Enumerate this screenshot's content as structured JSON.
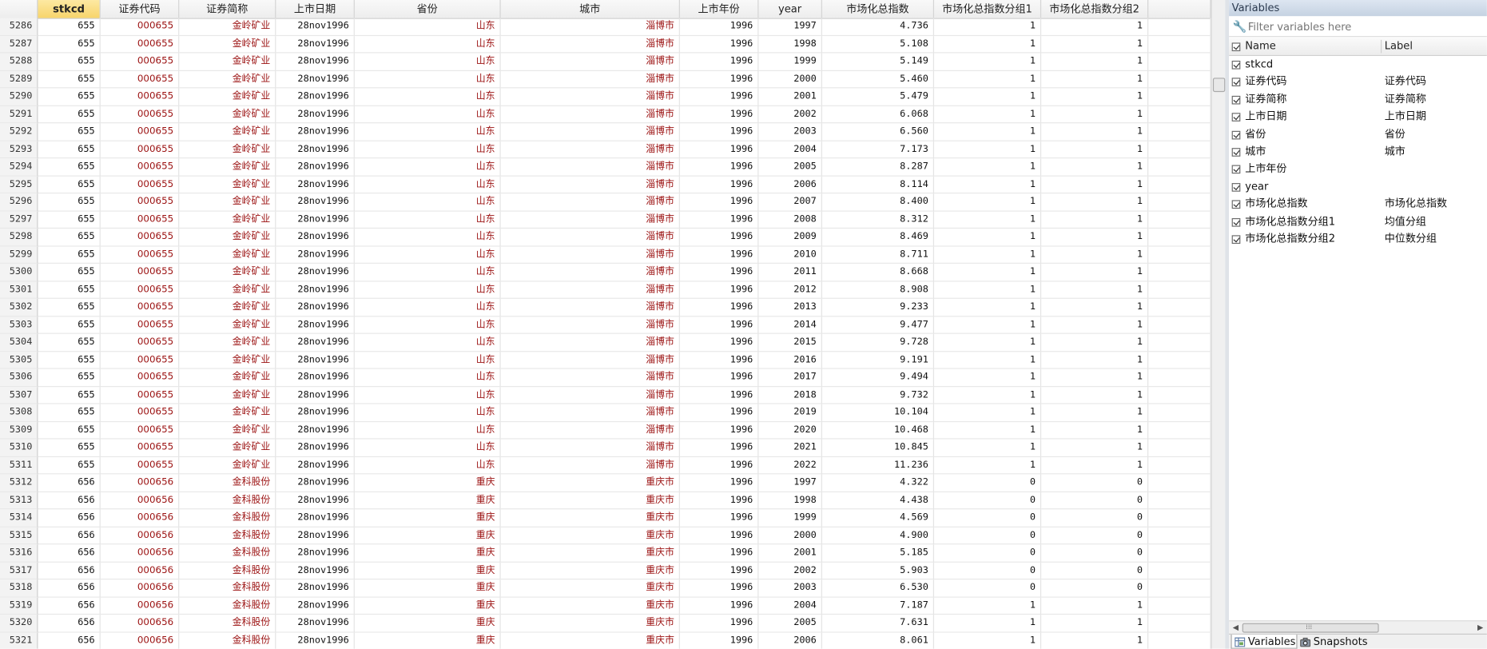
{
  "grid": {
    "columns": [
      {
        "name": "stkcd",
        "selected": true
      },
      {
        "name": "证券代码"
      },
      {
        "name": "证券简称"
      },
      {
        "name": "上市日期"
      },
      {
        "name": "省份"
      },
      {
        "name": "城市"
      },
      {
        "name": "上市年份"
      },
      {
        "name": "year"
      },
      {
        "name": "市场化总指数"
      },
      {
        "name": "市场化总指数分组1"
      },
      {
        "name": "市场化总指数分组2"
      }
    ],
    "string_columns": [
      1,
      2,
      4,
      5
    ],
    "rows": [
      [
        "5286",
        "655",
        "000655",
        "金岭矿业",
        "28nov1996",
        "山东",
        "淄博市",
        "1996",
        "1997",
        "4.736",
        "1",
        "1"
      ],
      [
        "5287",
        "655",
        "000655",
        "金岭矿业",
        "28nov1996",
        "山东",
        "淄博市",
        "1996",
        "1998",
        "5.108",
        "1",
        "1"
      ],
      [
        "5288",
        "655",
        "000655",
        "金岭矿业",
        "28nov1996",
        "山东",
        "淄博市",
        "1996",
        "1999",
        "5.149",
        "1",
        "1"
      ],
      [
        "5289",
        "655",
        "000655",
        "金岭矿业",
        "28nov1996",
        "山东",
        "淄博市",
        "1996",
        "2000",
        "5.460",
        "1",
        "1"
      ],
      [
        "5290",
        "655",
        "000655",
        "金岭矿业",
        "28nov1996",
        "山东",
        "淄博市",
        "1996",
        "2001",
        "5.479",
        "1",
        "1"
      ],
      [
        "5291",
        "655",
        "000655",
        "金岭矿业",
        "28nov1996",
        "山东",
        "淄博市",
        "1996",
        "2002",
        "6.068",
        "1",
        "1"
      ],
      [
        "5292",
        "655",
        "000655",
        "金岭矿业",
        "28nov1996",
        "山东",
        "淄博市",
        "1996",
        "2003",
        "6.560",
        "1",
        "1"
      ],
      [
        "5293",
        "655",
        "000655",
        "金岭矿业",
        "28nov1996",
        "山东",
        "淄博市",
        "1996",
        "2004",
        "7.173",
        "1",
        "1"
      ],
      [
        "5294",
        "655",
        "000655",
        "金岭矿业",
        "28nov1996",
        "山东",
        "淄博市",
        "1996",
        "2005",
        "8.287",
        "1",
        "1"
      ],
      [
        "5295",
        "655",
        "000655",
        "金岭矿业",
        "28nov1996",
        "山东",
        "淄博市",
        "1996",
        "2006",
        "8.114",
        "1",
        "1"
      ],
      [
        "5296",
        "655",
        "000655",
        "金岭矿业",
        "28nov1996",
        "山东",
        "淄博市",
        "1996",
        "2007",
        "8.400",
        "1",
        "1"
      ],
      [
        "5297",
        "655",
        "000655",
        "金岭矿业",
        "28nov1996",
        "山东",
        "淄博市",
        "1996",
        "2008",
        "8.312",
        "1",
        "1"
      ],
      [
        "5298",
        "655",
        "000655",
        "金岭矿业",
        "28nov1996",
        "山东",
        "淄博市",
        "1996",
        "2009",
        "8.469",
        "1",
        "1"
      ],
      [
        "5299",
        "655",
        "000655",
        "金岭矿业",
        "28nov1996",
        "山东",
        "淄博市",
        "1996",
        "2010",
        "8.711",
        "1",
        "1"
      ],
      [
        "5300",
        "655",
        "000655",
        "金岭矿业",
        "28nov1996",
        "山东",
        "淄博市",
        "1996",
        "2011",
        "8.668",
        "1",
        "1"
      ],
      [
        "5301",
        "655",
        "000655",
        "金岭矿业",
        "28nov1996",
        "山东",
        "淄博市",
        "1996",
        "2012",
        "8.908",
        "1",
        "1"
      ],
      [
        "5302",
        "655",
        "000655",
        "金岭矿业",
        "28nov1996",
        "山东",
        "淄博市",
        "1996",
        "2013",
        "9.233",
        "1",
        "1"
      ],
      [
        "5303",
        "655",
        "000655",
        "金岭矿业",
        "28nov1996",
        "山东",
        "淄博市",
        "1996",
        "2014",
        "9.477",
        "1",
        "1"
      ],
      [
        "5304",
        "655",
        "000655",
        "金岭矿业",
        "28nov1996",
        "山东",
        "淄博市",
        "1996",
        "2015",
        "9.728",
        "1",
        "1"
      ],
      [
        "5305",
        "655",
        "000655",
        "金岭矿业",
        "28nov1996",
        "山东",
        "淄博市",
        "1996",
        "2016",
        "9.191",
        "1",
        "1"
      ],
      [
        "5306",
        "655",
        "000655",
        "金岭矿业",
        "28nov1996",
        "山东",
        "淄博市",
        "1996",
        "2017",
        "9.494",
        "1",
        "1"
      ],
      [
        "5307",
        "655",
        "000655",
        "金岭矿业",
        "28nov1996",
        "山东",
        "淄博市",
        "1996",
        "2018",
        "9.732",
        "1",
        "1"
      ],
      [
        "5308",
        "655",
        "000655",
        "金岭矿业",
        "28nov1996",
        "山东",
        "淄博市",
        "1996",
        "2019",
        "10.104",
        "1",
        "1"
      ],
      [
        "5309",
        "655",
        "000655",
        "金岭矿业",
        "28nov1996",
        "山东",
        "淄博市",
        "1996",
        "2020",
        "10.468",
        "1",
        "1"
      ],
      [
        "5310",
        "655",
        "000655",
        "金岭矿业",
        "28nov1996",
        "山东",
        "淄博市",
        "1996",
        "2021",
        "10.845",
        "1",
        "1"
      ],
      [
        "5311",
        "655",
        "000655",
        "金岭矿业",
        "28nov1996",
        "山东",
        "淄博市",
        "1996",
        "2022",
        "11.236",
        "1",
        "1"
      ],
      [
        "5312",
        "656",
        "000656",
        "金科股份",
        "28nov1996",
        "重庆",
        "重庆市",
        "1996",
        "1997",
        "4.322",
        "0",
        "0"
      ],
      [
        "5313",
        "656",
        "000656",
        "金科股份",
        "28nov1996",
        "重庆",
        "重庆市",
        "1996",
        "1998",
        "4.438",
        "0",
        "0"
      ],
      [
        "5314",
        "656",
        "000656",
        "金科股份",
        "28nov1996",
        "重庆",
        "重庆市",
        "1996",
        "1999",
        "4.569",
        "0",
        "0"
      ],
      [
        "5315",
        "656",
        "000656",
        "金科股份",
        "28nov1996",
        "重庆",
        "重庆市",
        "1996",
        "2000",
        "4.900",
        "0",
        "0"
      ],
      [
        "5316",
        "656",
        "000656",
        "金科股份",
        "28nov1996",
        "重庆",
        "重庆市",
        "1996",
        "2001",
        "5.185",
        "0",
        "0"
      ],
      [
        "5317",
        "656",
        "000656",
        "金科股份",
        "28nov1996",
        "重庆",
        "重庆市",
        "1996",
        "2002",
        "5.903",
        "0",
        "0"
      ],
      [
        "5318",
        "656",
        "000656",
        "金科股份",
        "28nov1996",
        "重庆",
        "重庆市",
        "1996",
        "2003",
        "6.530",
        "0",
        "0"
      ],
      [
        "5319",
        "656",
        "000656",
        "金科股份",
        "28nov1996",
        "重庆",
        "重庆市",
        "1996",
        "2004",
        "7.187",
        "1",
        "1"
      ],
      [
        "5320",
        "656",
        "000656",
        "金科股份",
        "28nov1996",
        "重庆",
        "重庆市",
        "1996",
        "2005",
        "7.631",
        "1",
        "1"
      ],
      [
        "5321",
        "656",
        "000656",
        "金科股份",
        "28nov1996",
        "重庆",
        "重庆市",
        "1996",
        "2006",
        "8.061",
        "1",
        "1"
      ]
    ]
  },
  "variables_pane": {
    "title": "Variables",
    "filter_placeholder": "Filter variables here",
    "filter_icon": "wrench-icon",
    "header": {
      "name": "Name",
      "label": "Label"
    },
    "items": [
      {
        "name": "stkcd",
        "label": ""
      },
      {
        "name": "证券代码",
        "label": "证券代码"
      },
      {
        "name": "证券简称",
        "label": "证券简称"
      },
      {
        "name": "上市日期",
        "label": "上市日期"
      },
      {
        "name": "省份",
        "label": "省份"
      },
      {
        "name": "城市",
        "label": "城市"
      },
      {
        "name": "上市年份",
        "label": ""
      },
      {
        "name": "year",
        "label": ""
      },
      {
        "name": "市场化总指数",
        "label": "市场化总指数"
      },
      {
        "name": "市场化总指数分组1",
        "label": "均值分组"
      },
      {
        "name": "市场化总指数分组2",
        "label": "中位数分组"
      }
    ],
    "tabs": [
      {
        "label": "Variables",
        "active": true,
        "icon": "variables-icon"
      },
      {
        "label": "Snapshots",
        "active": false,
        "icon": "camera-icon"
      }
    ]
  },
  "colors": {
    "string_text": "#9b1111",
    "selected_header": "#f7d46b",
    "pane_title": "#c5d2e2"
  }
}
